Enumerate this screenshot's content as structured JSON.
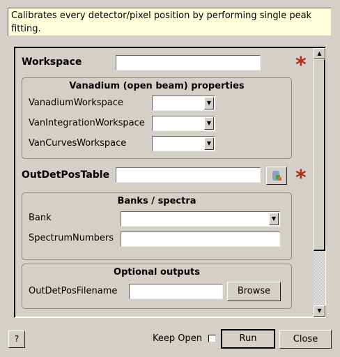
{
  "description": "Calibrates every detector/pixel position by performing single peak fitting.",
  "workspace": {
    "label": "Workspace",
    "value": ""
  },
  "vanadium": {
    "title": "Vanadium (open beam) properties",
    "rows": [
      {
        "label": "VanadiumWorkspace"
      },
      {
        "label": "VanIntegrationWorkspace"
      },
      {
        "label": "VanCurvesWorkspace"
      }
    ]
  },
  "outdet": {
    "label": "OutDetPosTable",
    "value": ""
  },
  "banks": {
    "title": "Banks / spectra",
    "bank_label": "Bank",
    "spectrum_label": "SpectrumNumbers"
  },
  "optional": {
    "title": "Optional outputs",
    "filename_label": "OutDetPosFilename",
    "browse": "Browse"
  },
  "required_marker": "*",
  "footer": {
    "help": "?",
    "keep_open": "Keep Open",
    "run": "Run",
    "close": "Close"
  }
}
